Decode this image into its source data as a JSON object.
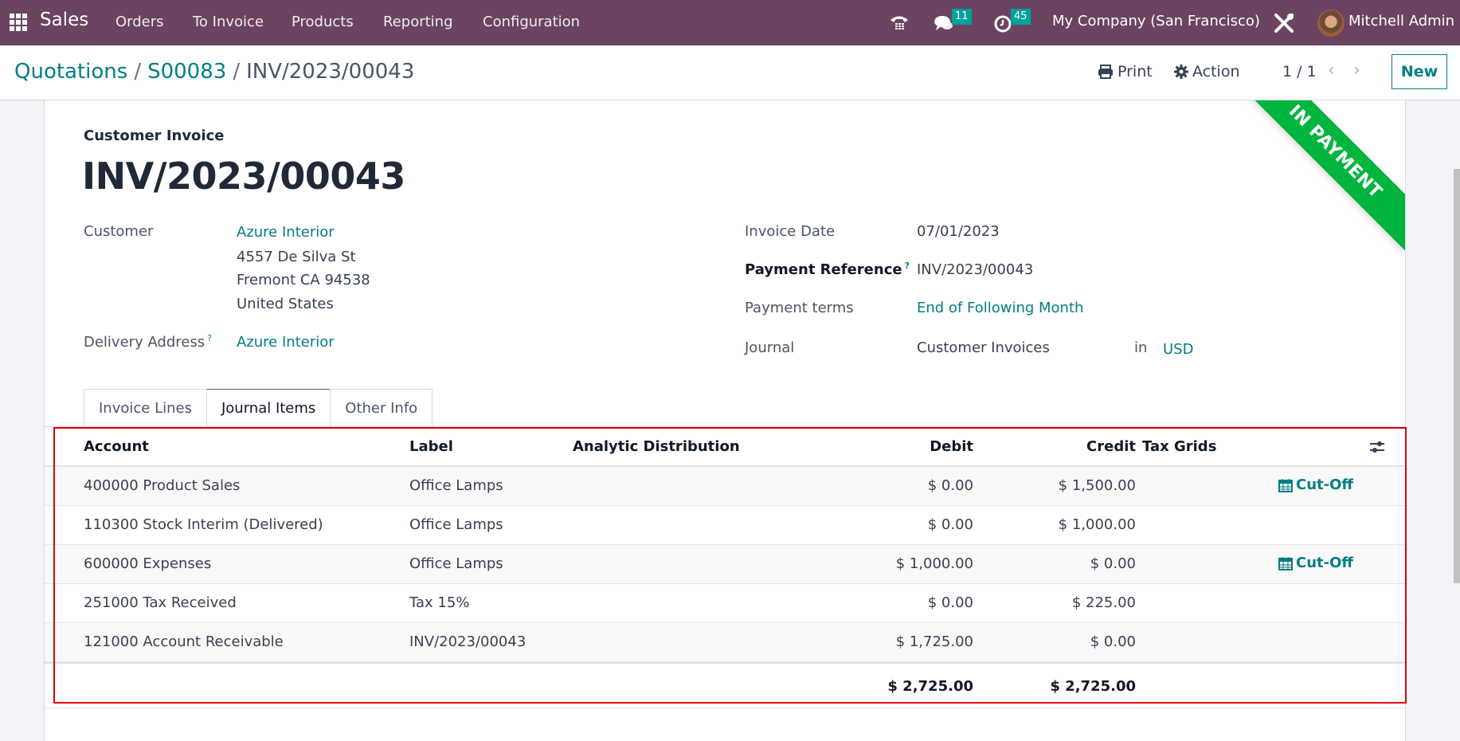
{
  "navbar": {
    "app_name": "Sales",
    "menu": [
      "Orders",
      "To Invoice",
      "Products",
      "Reporting",
      "Configuration"
    ],
    "messages_count": "11",
    "activities_count": "45",
    "company": "My Company (San Francisco)",
    "user": "Mitchell Admin",
    "brand_color": "#6b4462"
  },
  "control_panel": {
    "breadcrumb": [
      "Quotations",
      "S00083",
      "INV/2023/00043"
    ],
    "print_label": "Print",
    "action_label": "Action",
    "pager": "1 / 1",
    "new_label": "New"
  },
  "form": {
    "doc_type": "Customer Invoice",
    "title": "INV/2023/00043",
    "ribbon": "IN PAYMENT",
    "ribbon_color": "#00b53d",
    "customer_label": "Customer",
    "customer_name": "Azure Interior",
    "customer_address": [
      "4557 De Silva St",
      "Fremont CA 94538",
      "United States"
    ],
    "delivery_label": "Delivery Address",
    "delivery_value": "Azure Interior",
    "invoice_date_label": "Invoice Date",
    "invoice_date": "07/01/2023",
    "payment_ref_label": "Payment Reference",
    "payment_ref": "INV/2023/00043",
    "payment_terms_label": "Payment terms",
    "payment_terms": "End of Following Month",
    "journal_label": "Journal",
    "journal": "Customer Invoices",
    "in_label": "in",
    "currency": "USD",
    "help_marker": "?"
  },
  "tabs": [
    {
      "label": "Invoice Lines",
      "active": false
    },
    {
      "label": "Journal Items",
      "active": true
    },
    {
      "label": "Other Info",
      "active": false
    }
  ],
  "journal_items": {
    "columns": [
      "Account",
      "Label",
      "Analytic Distribution",
      "Debit",
      "Credit",
      "Tax Grids"
    ],
    "rows": [
      {
        "account": "400000 Product Sales",
        "label": "Office Lamps",
        "debit": "$ 0.00",
        "credit": "$ 1,500.00",
        "cutoff": "Cut-Off"
      },
      {
        "account": "110300 Stock Interim (Delivered)",
        "label": "Office Lamps",
        "debit": "$ 0.00",
        "credit": "$ 1,000.00",
        "cutoff": ""
      },
      {
        "account": "600000 Expenses",
        "label": "Office Lamps",
        "debit": "$ 1,000.00",
        "credit": "$ 0.00",
        "cutoff": "Cut-Off"
      },
      {
        "account": "251000 Tax Received",
        "label": "Tax 15%",
        "debit": "$ 0.00",
        "credit": "$ 225.00",
        "cutoff": ""
      },
      {
        "account": "121000 Account Receivable",
        "label": "INV/2023/00043",
        "debit": "$ 1,725.00",
        "credit": "$ 0.00",
        "cutoff": ""
      }
    ],
    "total_debit": "$ 2,725.00",
    "total_credit": "$ 2,725.00"
  }
}
